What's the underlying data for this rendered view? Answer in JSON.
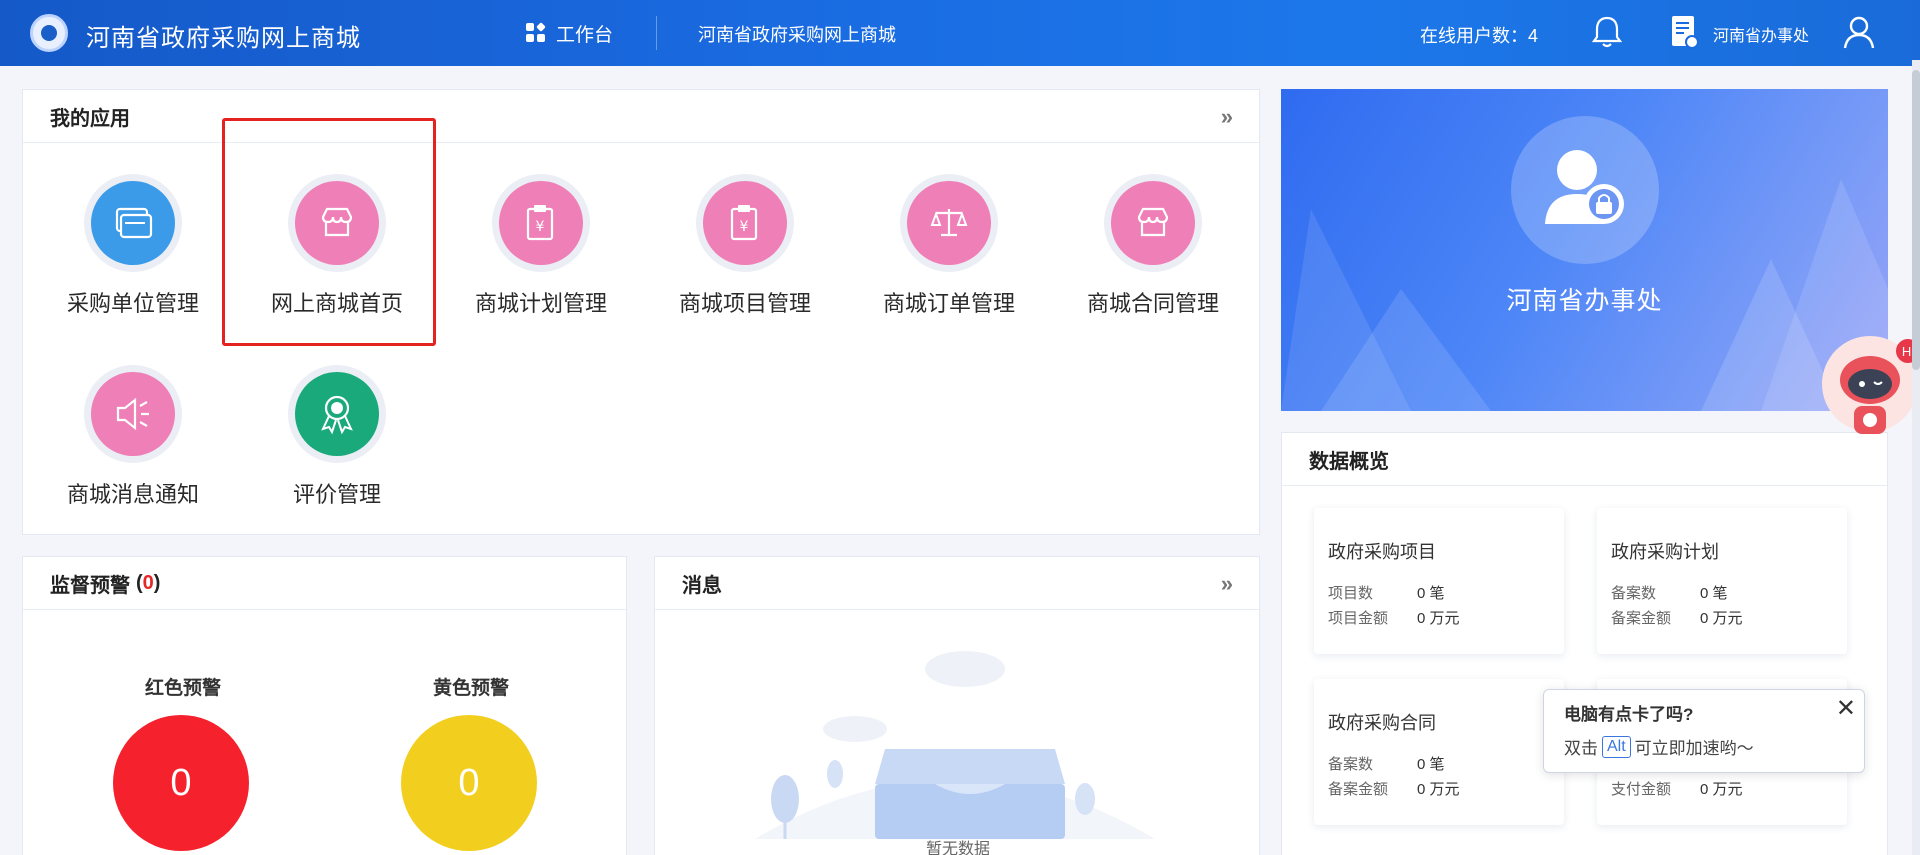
{
  "header": {
    "title": "河南省政府采购网上商城",
    "nav_workbench": "工作台",
    "nav_mall": "河南省政府采购网上商城",
    "online_users": "在线用户数：4",
    "user_name": "河南省办事处"
  },
  "my_apps": {
    "title": "我的应用",
    "more": "»",
    "items": [
      {
        "label": "采购单位管理",
        "icon": "cards-icon",
        "color": "#3b9be8"
      },
      {
        "label": "网上商城首页",
        "icon": "shop-icon",
        "color": "#ee7fb7"
      },
      {
        "label": "商城计划管理",
        "icon": "yuan-clipboard-icon",
        "color": "#ee7fb7"
      },
      {
        "label": "商城项目管理",
        "icon": "yuan-clipboard-icon",
        "color": "#ee7fb7"
      },
      {
        "label": "商城订单管理",
        "icon": "scale-icon",
        "color": "#ee7fb7"
      },
      {
        "label": "商城合同管理",
        "icon": "shop-icon",
        "color": "#ee7fb7"
      },
      {
        "label": "商城消息通知",
        "icon": "speaker-icon",
        "color": "#ee7fb7"
      },
      {
        "label": "评价管理",
        "icon": "award-icon",
        "color": "#1aa97a"
      }
    ]
  },
  "profile": {
    "name": "河南省办事处"
  },
  "overview": {
    "title": "数据概览",
    "cards": [
      {
        "title": "政府采购项目",
        "rows": [
          {
            "label": "项目数",
            "value": "0 笔"
          },
          {
            "label": "项目金额",
            "value": "0 万元"
          }
        ]
      },
      {
        "title": "政府采购计划",
        "rows": [
          {
            "label": "备案数",
            "value": "0 笔"
          },
          {
            "label": "备案金额",
            "value": "0 万元"
          }
        ]
      },
      {
        "title": "政府采购合同",
        "rows": [
          {
            "label": "备案数",
            "value": "0 笔"
          },
          {
            "label": "备案金额",
            "value": "0 万元"
          }
        ]
      },
      {
        "title": "",
        "rows": [
          {
            "label": "支付金额",
            "value": "0 万元"
          }
        ]
      }
    ]
  },
  "warning": {
    "title": "监督预警",
    "count_open": "(",
    "count": "0",
    "count_close": ")",
    "red_label": "红色预警",
    "red_value": "0",
    "red_color": "#f5222d",
    "yellow_label": "黄色预警",
    "yellow_value": "0",
    "yellow_color": "#f2cf1f"
  },
  "messages": {
    "title": "消息",
    "more": "»",
    "empty": "暂无数据"
  },
  "tooltip": {
    "title": "电脑有点卡了吗?",
    "close": "✕",
    "body_prefix": "双击",
    "key": "Alt",
    "body_suffix": "可立即加速哟～"
  },
  "robot": {
    "badge": "Hi"
  }
}
